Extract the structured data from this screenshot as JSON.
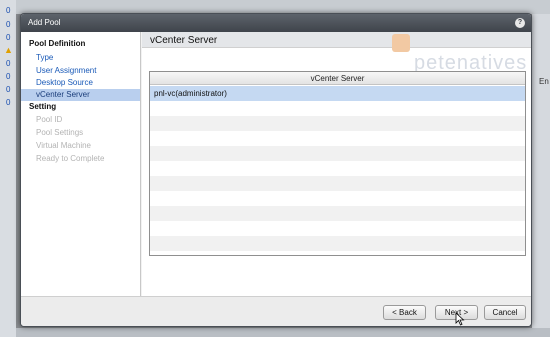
{
  "background": {
    "left_column_values": [
      "0",
      "0",
      "0",
      "0",
      "0",
      "0",
      "0"
    ],
    "right_column_label": "En"
  },
  "dialog": {
    "title": "Add Pool",
    "help_icon": "help-icon"
  },
  "sidebar": {
    "sections": [
      {
        "title": "Pool Definition",
        "items": [
          {
            "label": "Type",
            "state": "link"
          },
          {
            "label": "User Assignment",
            "state": "link"
          },
          {
            "label": "Desktop Source",
            "state": "link"
          },
          {
            "label": "vCenter Server",
            "state": "active"
          }
        ]
      },
      {
        "title": "Setting",
        "items": [
          {
            "label": "Pool ID",
            "state": "disabled"
          },
          {
            "label": "Pool Settings",
            "state": "disabled"
          },
          {
            "label": "Virtual Machine",
            "state": "disabled"
          },
          {
            "label": "Ready to Complete",
            "state": "disabled"
          }
        ]
      }
    ]
  },
  "content": {
    "title": "vCenter Server",
    "watermark": "petenatives",
    "grid": {
      "column_header": "vCenter Server",
      "rows": [
        {
          "value": "pnl-vc(administrator)",
          "selected": true
        }
      ]
    }
  },
  "footer": {
    "back_label": "< Back",
    "next_label": "Next >",
    "cancel_label": "Cancel"
  },
  "colors": {
    "titlebar": "#4a4f56",
    "selected_row": "#c5d9f2",
    "active_nav": "#b9cfee",
    "link": "#1a5ab8"
  }
}
